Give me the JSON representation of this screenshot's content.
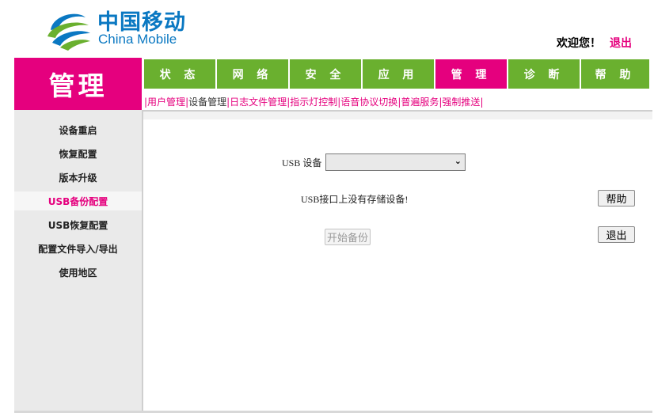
{
  "brand": {
    "name_cn": "中国移动",
    "name_en": "China Mobile",
    "logo_icon": "china-mobile-swirl-icon",
    "colors": {
      "blue": "#0a78c2",
      "green": "#6ab02f",
      "magenta": "#e5007e"
    }
  },
  "header": {
    "welcome": "欢迎您！",
    "logout": "退出"
  },
  "section_title": "管理",
  "topnav": [
    {
      "label": "状 态",
      "active": false
    },
    {
      "label": "网 络",
      "active": false
    },
    {
      "label": "安 全",
      "active": false
    },
    {
      "label": "应 用",
      "active": false
    },
    {
      "label": "管 理",
      "active": true
    },
    {
      "label": "诊 断",
      "active": false
    },
    {
      "label": "帮 助",
      "active": false
    }
  ],
  "subnav": [
    {
      "label": "用户管理",
      "active": false
    },
    {
      "label": "设备管理",
      "active": true
    },
    {
      "label": "日志文件管理",
      "active": false
    },
    {
      "label": "指示灯控制",
      "active": false
    },
    {
      "label": "语音协议切换",
      "active": false
    },
    {
      "label": "普遍服务",
      "active": false
    },
    {
      "label": "强制推送",
      "active": false
    }
  ],
  "sidebar": [
    {
      "label": "设备重启",
      "active": false
    },
    {
      "label": "恢复配置",
      "active": false
    },
    {
      "label": "版本升级",
      "active": false
    },
    {
      "label": "USB备份配置",
      "active": true
    },
    {
      "label": "USB恢复配置",
      "active": false
    },
    {
      "label": "配置文件导入/导出",
      "active": false
    },
    {
      "label": "使用地区",
      "active": false
    }
  ],
  "form": {
    "usb_device_label": "USB 设备",
    "usb_device_value": "",
    "no_storage_msg": "USB接口上没有存储设备!",
    "start_backup": "开始备份",
    "help": "帮助",
    "exit": "退出"
  }
}
